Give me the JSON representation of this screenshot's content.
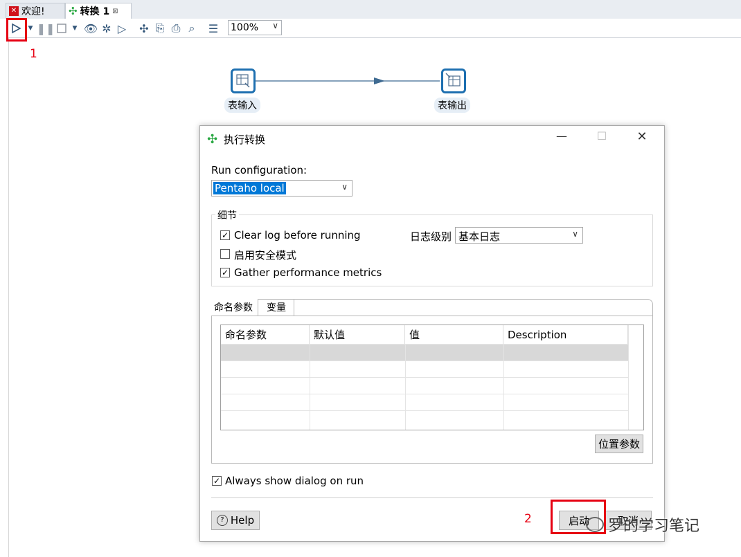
{
  "tabs": [
    {
      "label": "欢迎!"
    },
    {
      "label": "转换 1"
    }
  ],
  "toolbar": {
    "zoom": "100%"
  },
  "canvas": {
    "steps": [
      {
        "label": "表输入"
      },
      {
        "label": "表输出"
      }
    ]
  },
  "dialog": {
    "title": "执行转换",
    "run_config_label": "Run configuration:",
    "run_config_value": "Pentaho local",
    "details_group": "细节",
    "clear_log": "Clear log before running",
    "safe_mode": "启用安全模式",
    "gather_metrics": "Gather performance metrics",
    "log_level_label": "日志级别",
    "log_level_value": "基本日志",
    "tabs": [
      "命名参数",
      "变量"
    ],
    "table": {
      "headers": [
        "命名参数",
        "默认值",
        "值",
        "Description"
      ]
    },
    "position_params_button": "位置参数",
    "always_show": "Always show dialog on run",
    "help_button": "Help",
    "start_button": "启动",
    "cancel_button": "取消"
  },
  "annotations": {
    "step1": "1",
    "step2": "2"
  },
  "watermark": "罗的学习笔记",
  "colors": {
    "annotation_red": "#e60012",
    "node_blue": "#1d6fb0",
    "accent_green": "#2aa843"
  }
}
